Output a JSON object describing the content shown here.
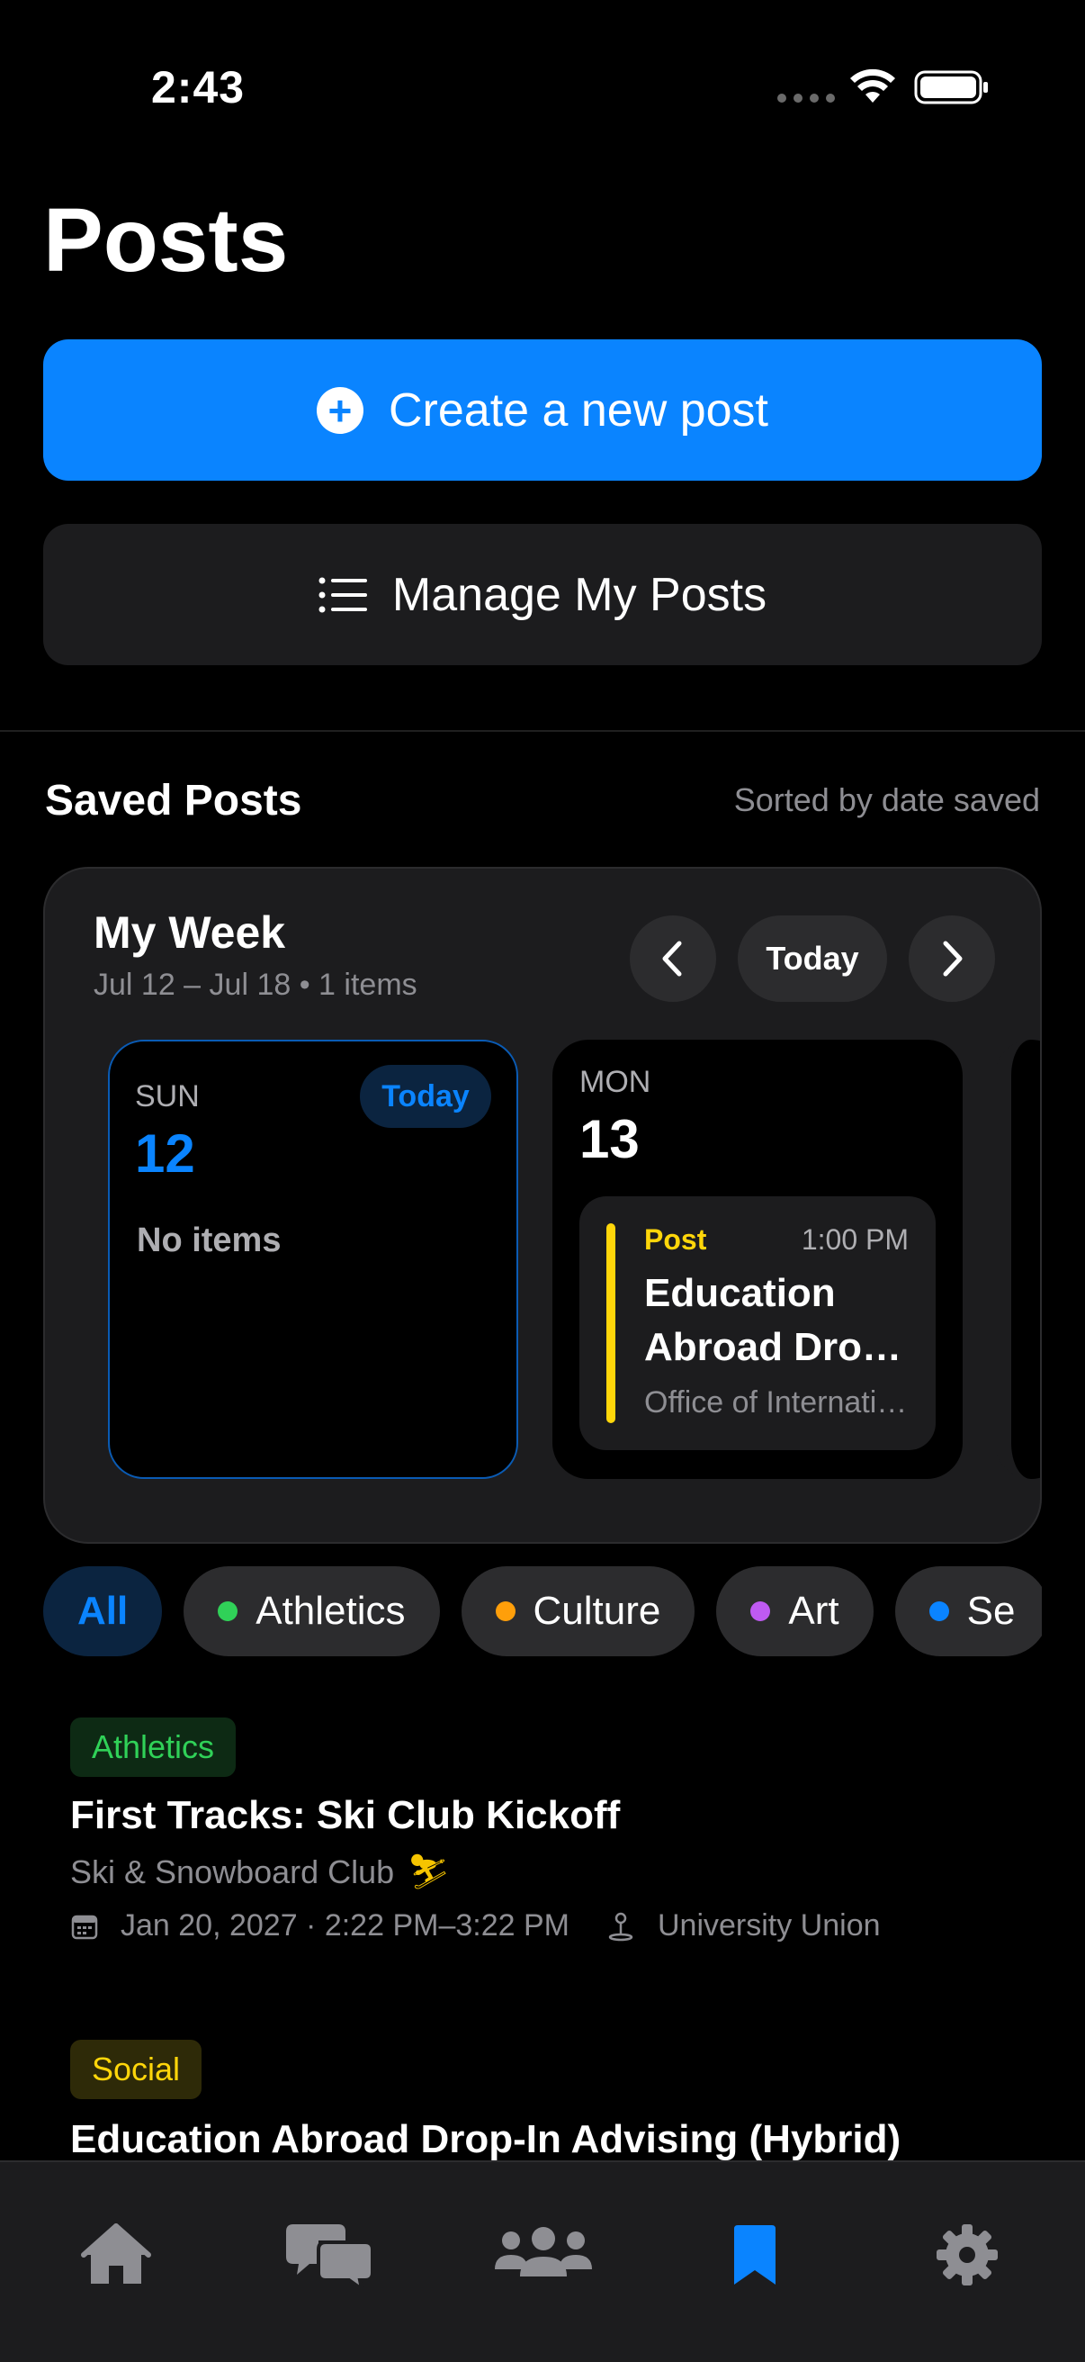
{
  "status_bar": {
    "time": "2:43"
  },
  "page": {
    "title": "Posts"
  },
  "actions": {
    "create_label": "Create a new post",
    "manage_label": "Manage My Posts"
  },
  "saved": {
    "title": "Saved Posts",
    "sort_label": "Sorted by date saved"
  },
  "week": {
    "title": "My Week",
    "range": "Jul 12 – Jul 18 • 1 items",
    "today_button": "Today",
    "days": [
      {
        "name": "SUN",
        "number": "12",
        "badge": "Today",
        "empty_text": "No items"
      },
      {
        "name": "MON",
        "number": "13",
        "event": {
          "tag": "Post",
          "time": "1:00 PM",
          "title_line1": "Education",
          "title_line2": "Abroad Drop-In Advising",
          "subtitle": "Office of International Programs"
        }
      }
    ]
  },
  "filters": {
    "items": [
      {
        "label": "All"
      },
      {
        "label": "Athletics",
        "color": "#30d158"
      },
      {
        "label": "Culture",
        "color": "#ff9f0a"
      },
      {
        "label": "Art",
        "color": "#bf5af2"
      },
      {
        "label": "Se",
        "color": "#0a84ff"
      }
    ]
  },
  "posts": [
    {
      "tag": "Athletics",
      "tag_color": "#30d158",
      "tag_bg": "#0d2a14",
      "title": "First Tracks: Ski Club Kickoff",
      "org": "Ski & Snowboard Club",
      "org_emoji": "⛷",
      "datetime": "Jan 20, 2027 · 2:22 PM–3:22 PM",
      "location": "University Union"
    },
    {
      "tag": "Social",
      "tag_color": "#ffd60a",
      "tag_bg": "#2e2a08",
      "title": "Education Abroad Drop-In Advising (Hybrid)"
    }
  ],
  "tabbar": {
    "icons": [
      "home-icon",
      "chat-bubbles-icon",
      "people-icon",
      "bookmark-icon",
      "gear-icon"
    ],
    "active_color": "#0a84ff",
    "inactive_color": "#8e8e93"
  }
}
